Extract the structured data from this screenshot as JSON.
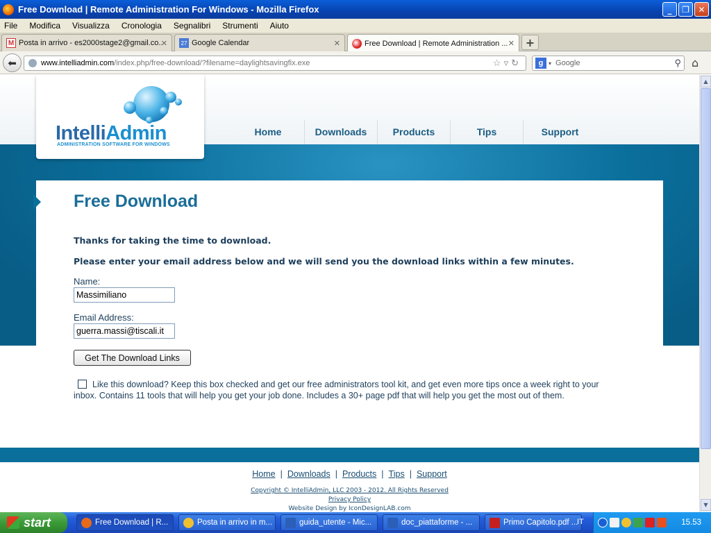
{
  "window": {
    "title": "Free Download | Remote Administration For Windows - Mozilla Firefox"
  },
  "menu": [
    "File",
    "Modifica",
    "Visualizza",
    "Cronologia",
    "Segnalibri",
    "Strumenti",
    "Aiuto"
  ],
  "tabs": [
    {
      "label": "Posta in arrivo - es2000stage2@gmail.co...",
      "icon": "gmail-icon"
    },
    {
      "label": "Google Calendar",
      "icon": "calendar-icon",
      "icon_text": "27"
    },
    {
      "label": "Free Download | Remote Administration ...",
      "icon": "intelliadmin-icon"
    }
  ],
  "navbar": {
    "url_domain": "www.intelliadmin.com",
    "url_path": "/index.php/free-download/?filename=daylightsavingfix.exe",
    "search_placeholder": "Google"
  },
  "site": {
    "logo_part1": "Intelli",
    "logo_part2": "Admin",
    "logo_tagline": "ADMINISTRATION SOFTWARE FOR WINDOWS",
    "nav": [
      "Home",
      "Downloads",
      "Products",
      "Tips",
      "Support"
    ]
  },
  "content": {
    "title": "Free Download",
    "thanks": "Thanks for taking the time to download.",
    "instructions": "Please enter your email address below and we will send you the download links within a few minutes.",
    "name_label": "Name:",
    "name_value": "Massimiliano",
    "email_label": "Email Address:",
    "email_value": "guerra.massi@tiscali.it",
    "submit_label": "Get The Download Links",
    "optin_checked": false,
    "optin_text": "Like this download? Keep this box checked and get our free administrators tool kit, and get even more tips once a week right to your inbox. Contains 11 tools that will help you get your job done. Includes a 30+ page pdf that will help you get the most out of them."
  },
  "footer": {
    "links": [
      "Home",
      "Downloads",
      "Products",
      "Tips",
      "Support"
    ],
    "copyright": "Copyright © IntelliAdmin, LLC 2003 - 2012. All Rights Reserved",
    "privacy": "Privacy Policy",
    "design": "Website Design by IconDesignLAB.com"
  },
  "taskbar": {
    "start_label": "start",
    "tasks": [
      {
        "label": "Free Download | R...",
        "icon_color": "#e66a1a"
      },
      {
        "label": "Posta in arrivo in m...",
        "icon_color": "#f0c030"
      },
      {
        "label": "guida_utente - Mic...",
        "icon_color": "#2b5fb8"
      },
      {
        "label": "doc_piattaforme - ...",
        "icon_color": "#2b5fb8"
      },
      {
        "label": "Primo Capitolo.pdf ...",
        "icon_color": "#c42020"
      }
    ],
    "language": "IT",
    "clock": "15.53"
  },
  "colors": {
    "brand_blue": "#0b6f9c",
    "title_blue": "#1a6e98",
    "text_navy": "#1d3e5a"
  }
}
